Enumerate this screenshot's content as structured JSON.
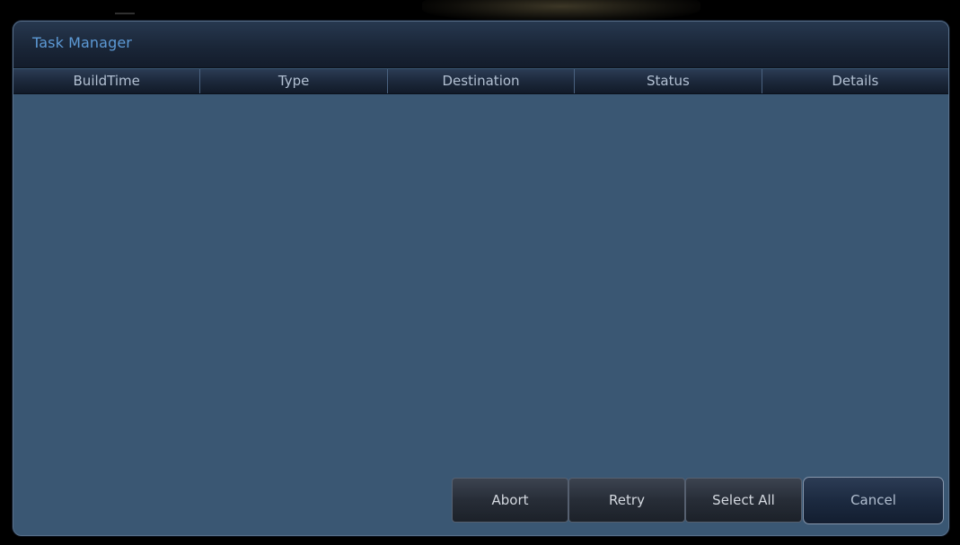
{
  "dialog": {
    "title": "Task Manager"
  },
  "table": {
    "columns": [
      "BuildTime",
      "Type",
      "Destination",
      "Status",
      "Details"
    ],
    "rows": []
  },
  "buttons": {
    "abort": "Abort",
    "retry": "Retry",
    "select_all": "Select All",
    "cancel": "Cancel"
  },
  "colors": {
    "title_text": "#5d9ad6",
    "list_background": "#3a5773",
    "header_background": "#1c283b",
    "header_text": "#b2c0d2"
  }
}
